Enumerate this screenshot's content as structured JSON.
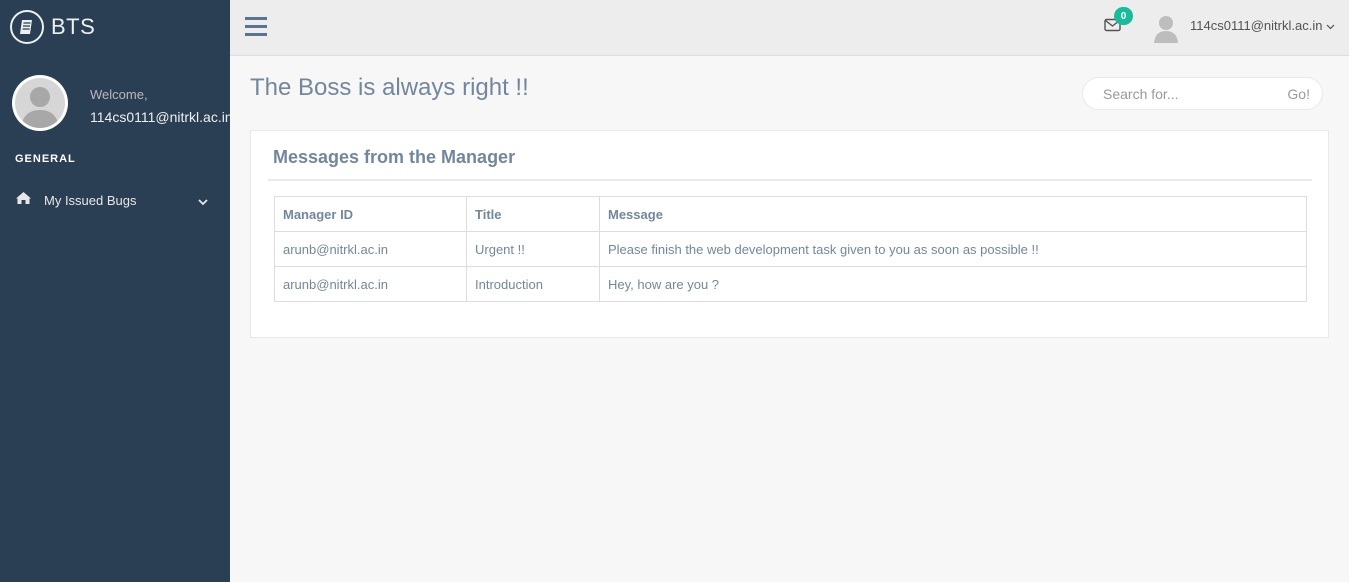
{
  "sidebar": {
    "brand_title": "BTS",
    "brand_icon": "book-icon",
    "welcome_label": "Welcome,",
    "user_email": "114cs0111@nitrkl.ac.in",
    "section_label": "GENERAL",
    "menu_items": [
      {
        "label": "My Issued Bugs",
        "icon": "home-icon"
      }
    ],
    "background_color": "#2a3f54"
  },
  "topnav": {
    "mail_count": "0",
    "user_email": "114cs0111@nitrkl.ac.in",
    "badge_color": "#1ABB9C"
  },
  "main": {
    "page_title": "The Boss is always right !!",
    "search": {
      "placeholder": "Search for...",
      "button_label": "Go!"
    },
    "panel": {
      "title": "Messages from the Manager",
      "columns": [
        "Manager ID",
        "Title",
        "Message"
      ],
      "rows": [
        [
          "arunb@nitrkl.ac.in",
          "Urgent !!",
          "Please finish the web development task given to you as soon as possible !!"
        ],
        [
          "arunb@nitrkl.ac.in",
          "Introduction",
          "Hey, how are you ?"
        ]
      ]
    }
  }
}
